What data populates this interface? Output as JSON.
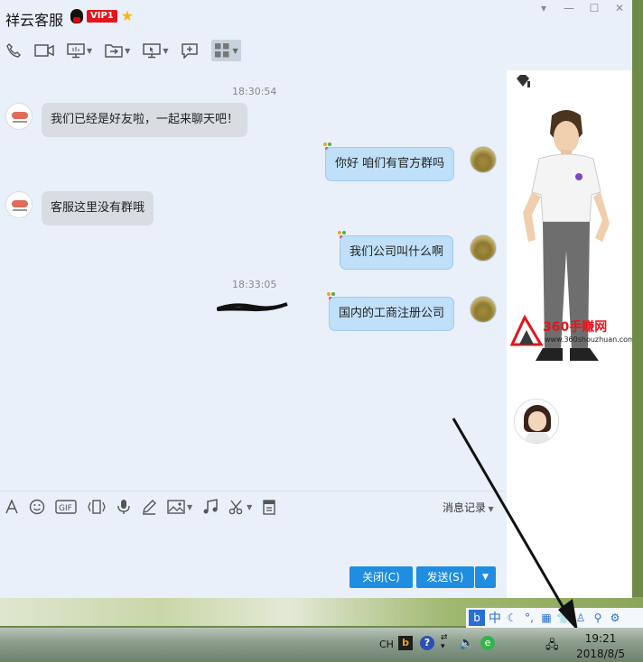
{
  "window": {
    "title": "祥云客服",
    "vip_label": "VIP1",
    "controls": [
      "▾",
      "—",
      "☐",
      "✕"
    ]
  },
  "toolbar": {
    "items": [
      "phone-icon",
      "video-icon",
      "screen-share-icon",
      "file-transfer-icon",
      "remote-desktop-icon",
      "add-contact-icon",
      "apps-grid-icon"
    ]
  },
  "chat": {
    "messages": [
      {
        "time": "18:30:54"
      },
      {
        "side": "left",
        "text": "我们已经是好友啦，一起来聊天吧！"
      },
      {
        "side": "right",
        "text": "你好  咱们有官方群吗"
      },
      {
        "side": "left",
        "text": "客服这里没有群哦"
      },
      {
        "side": "right",
        "text": "我们公司叫什么啊"
      },
      {
        "time": "18:33:05"
      },
      {
        "side": "right",
        "text": "国内的工商注册公司"
      }
    ]
  },
  "side_panel": {
    "watermark_title": "360手赚网",
    "watermark_url": "www.360shouzhuan.com"
  },
  "input_toolbar": {
    "items": [
      "font-icon",
      "emoji-icon",
      "gif-icon",
      "shake-icon",
      "voice-icon",
      "doodle-icon",
      "image-icon",
      "music-icon",
      "screenshot-icon",
      "history-file-icon"
    ],
    "history_label": "消息记录"
  },
  "buttons": {
    "close_label": "关闭(C)",
    "send_label": "发送(S)"
  },
  "ime_bar": {
    "mode_label": "中"
  },
  "taskbar": {
    "lang": "CH",
    "time": "19:21",
    "date": "2018/8/5"
  },
  "colors": {
    "accent": "#1f8ee0",
    "vip_red": "#e4141d",
    "bubble_right": "#bfe0f8",
    "bubble_left": "#d9dde3"
  }
}
